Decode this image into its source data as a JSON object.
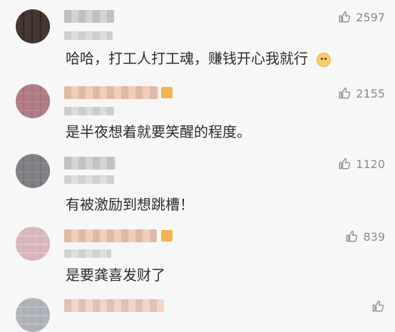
{
  "comments": [
    {
      "likes": "2597",
      "text": "哈哈，打工人打工魂，赚钱开心我就行"
    },
    {
      "likes": "2155",
      "text": "是半夜想着就要笑醒的程度。"
    },
    {
      "likes": "1120",
      "text": "有被激励到想跳槽！"
    },
    {
      "likes": "839",
      "text": "是要龚喜发财了"
    }
  ],
  "icons": {
    "like": "thumbs-up-icon",
    "emoji": "dog-face-emoji-icon"
  }
}
